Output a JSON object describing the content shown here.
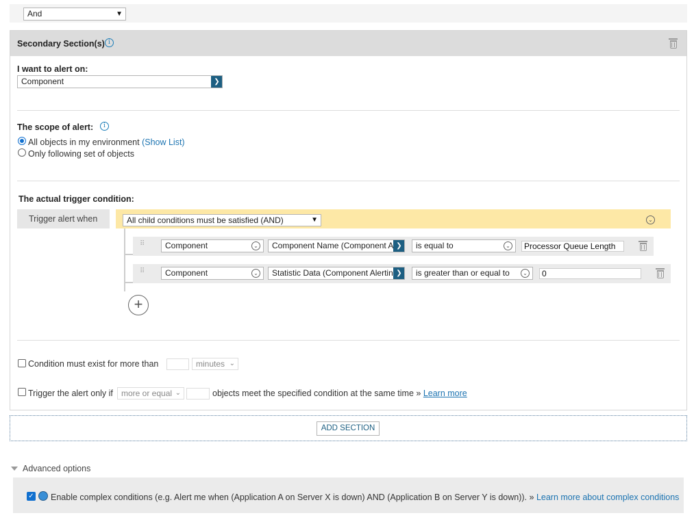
{
  "top": {
    "operator_select": "And"
  },
  "secondary": {
    "header_title": "Secondary Section(s)",
    "alert_on_label": "I want to alert on:",
    "alert_on_value": "Component",
    "scope_label": "The scope of alert:",
    "scope_all": "All objects in my environment",
    "scope_show_list": "(Show List)",
    "scope_following": "Only following set of objects",
    "trigger_label": "The actual trigger condition:",
    "trigger_when": "Trigger alert when",
    "trigger_group_select": "All child conditions must be satisfied (AND)",
    "conditions": [
      {
        "object": "Component",
        "field": "Component Name (Component A",
        "operator": "is equal to",
        "value": "Processor Queue Length"
      },
      {
        "object": "Component",
        "field": "Statistic Data (Component Alertin",
        "operator": "is greater than or equal to",
        "value": "0"
      }
    ],
    "condition_exist_label": "Condition must exist for more than",
    "minutes_select": "minutes",
    "trigger_only_if_label": "Trigger the alert only if",
    "more_or_equal_select": "more or equal",
    "objects_meet_label": "objects meet the specified condition at the same time »",
    "learn_more": "Learn more"
  },
  "add_section_button": "ADD SECTION",
  "advanced": {
    "label": "Advanced options",
    "complex_label": "Enable complex conditions (e.g. Alert me when (Application A on Server X is down) AND (Application B on Server Y is down)). »",
    "complex_link": "Learn more about complex conditions",
    "complex_checked": true
  },
  "icons": {
    "info": "info-icon",
    "trash": "trash-icon",
    "drag": "drag-handle-icon",
    "add": "add-condition-icon",
    "chevron": "chevron-down-icon",
    "triangle": "triangle-down-icon",
    "app": "application-icon"
  },
  "colors": {
    "accent": "#1d5f82",
    "link": "#1b73b1",
    "trigger_bar": "#fde8a6",
    "header_bg": "#dcdcdc"
  }
}
